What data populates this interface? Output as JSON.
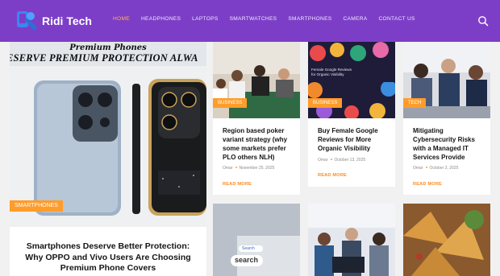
{
  "site": {
    "name": "Ridi Tech"
  },
  "nav": {
    "items": [
      "HOME",
      "HEADPHONES",
      "LAPTOPS",
      "SMARTWATCHES",
      "SMARTPHONES",
      "CAMERA",
      "CONTACT US"
    ]
  },
  "hero": {
    "image_kicker": "Premium Phones",
    "image_banner": "ESERVE PREMIUM PROTECTION ALWA",
    "tag": "SMARTPHONES",
    "title": "Smartphones Deserve Better Protection: Why OPPO and Vivo Users Are Choosing Premium Phone Covers"
  },
  "cards": [
    {
      "tag": "BUSINESS",
      "title": "Region based poker variant strategy (why some markets prefer PLO others NLH)",
      "author": "Omar",
      "date": "November 25, 2025",
      "more": "READ MORE"
    },
    {
      "tag": "BUSINESS",
      "title": "Buy Female Google Reviews for More Organic Visibility",
      "author": "Omar",
      "date": "October 13, 2025",
      "more": "READ MORE",
      "image_caption": "Female Google Reviews\nfor Organic Visibility"
    },
    {
      "tag": "TECH",
      "title": "Mitigating Cybersecurity Risks with a Managed IT Services Provide",
      "author": "Omar",
      "date": "October 3, 2025",
      "more": "READ MORE"
    }
  ],
  "bottom_cards": [
    {
      "image_text_1": "Search",
      "image_text_2": "search"
    },
    {},
    {}
  ],
  "colors": {
    "header": "#7d3ec7",
    "accent": "#ff9c2a",
    "nav_active": "#ffb35c"
  }
}
